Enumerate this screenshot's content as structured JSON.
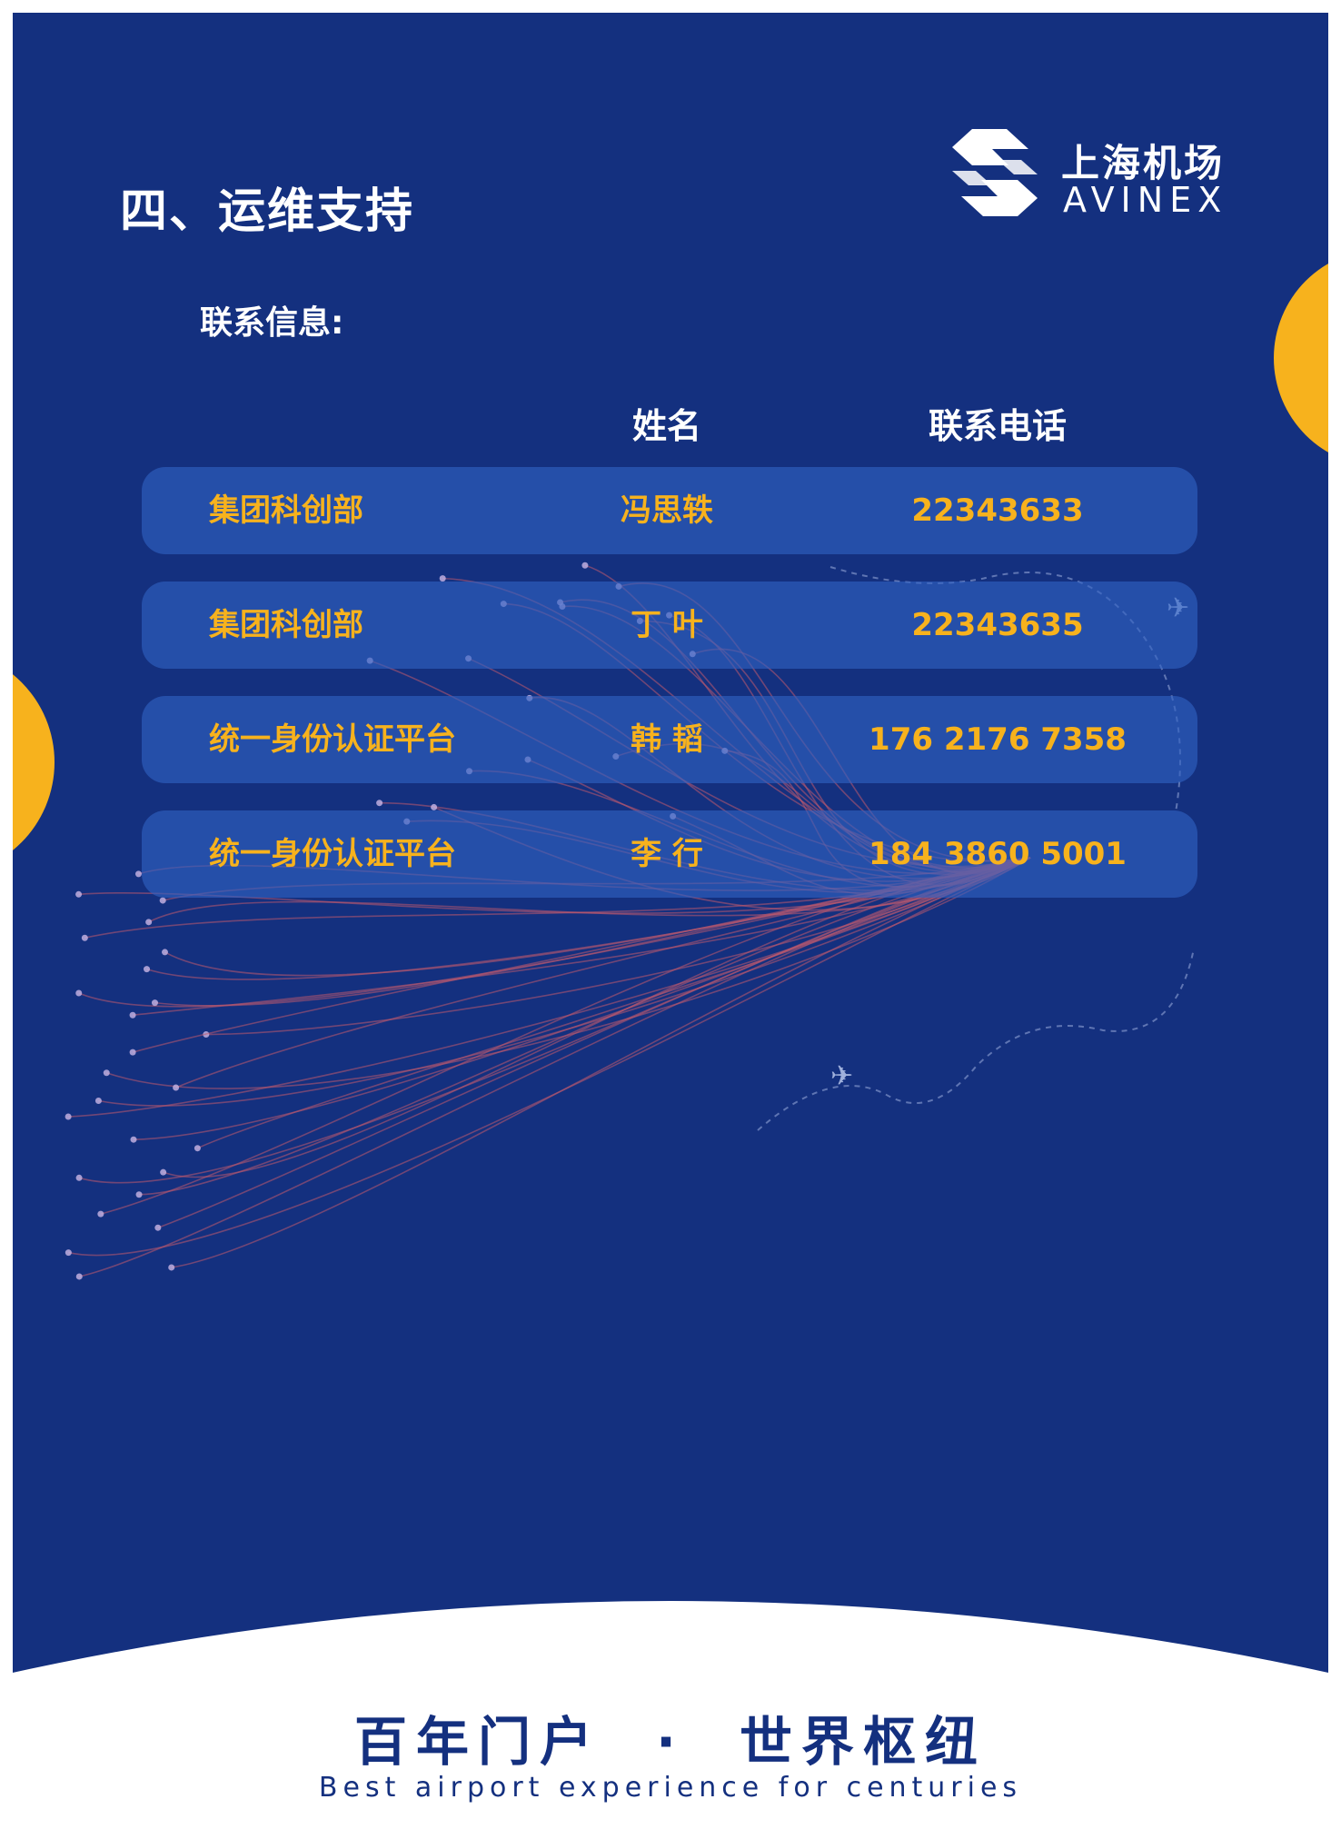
{
  "title": "四、运维支持",
  "logo": {
    "cn": "上海机场",
    "en": "AVINEX"
  },
  "section_label": "联系信息:",
  "table": {
    "headers": {
      "name": "姓名",
      "phone": "联系电话"
    },
    "rows": [
      {
        "dept": "集团科创部",
        "name": "冯思轶",
        "phone": "22343633"
      },
      {
        "dept": "集团科创部",
        "name": "丁 叶",
        "phone": "22343635"
      },
      {
        "dept": "统一身份认证平台",
        "name": "韩 韬",
        "phone": "176 2176 7358"
      },
      {
        "dept": "统一身份认证平台",
        "name": "李 行",
        "phone": "184 3860 5001"
      }
    ]
  },
  "footer": {
    "slogan_left": "百年门户",
    "slogan_dot": "·",
    "slogan_right": "世界枢纽",
    "tagline": "Best airport experience for centuries"
  },
  "colors": {
    "background_blue": "#14307f",
    "accent_yellow": "#f7b21d",
    "row_blue": "#3062c4",
    "white": "#ffffff"
  }
}
